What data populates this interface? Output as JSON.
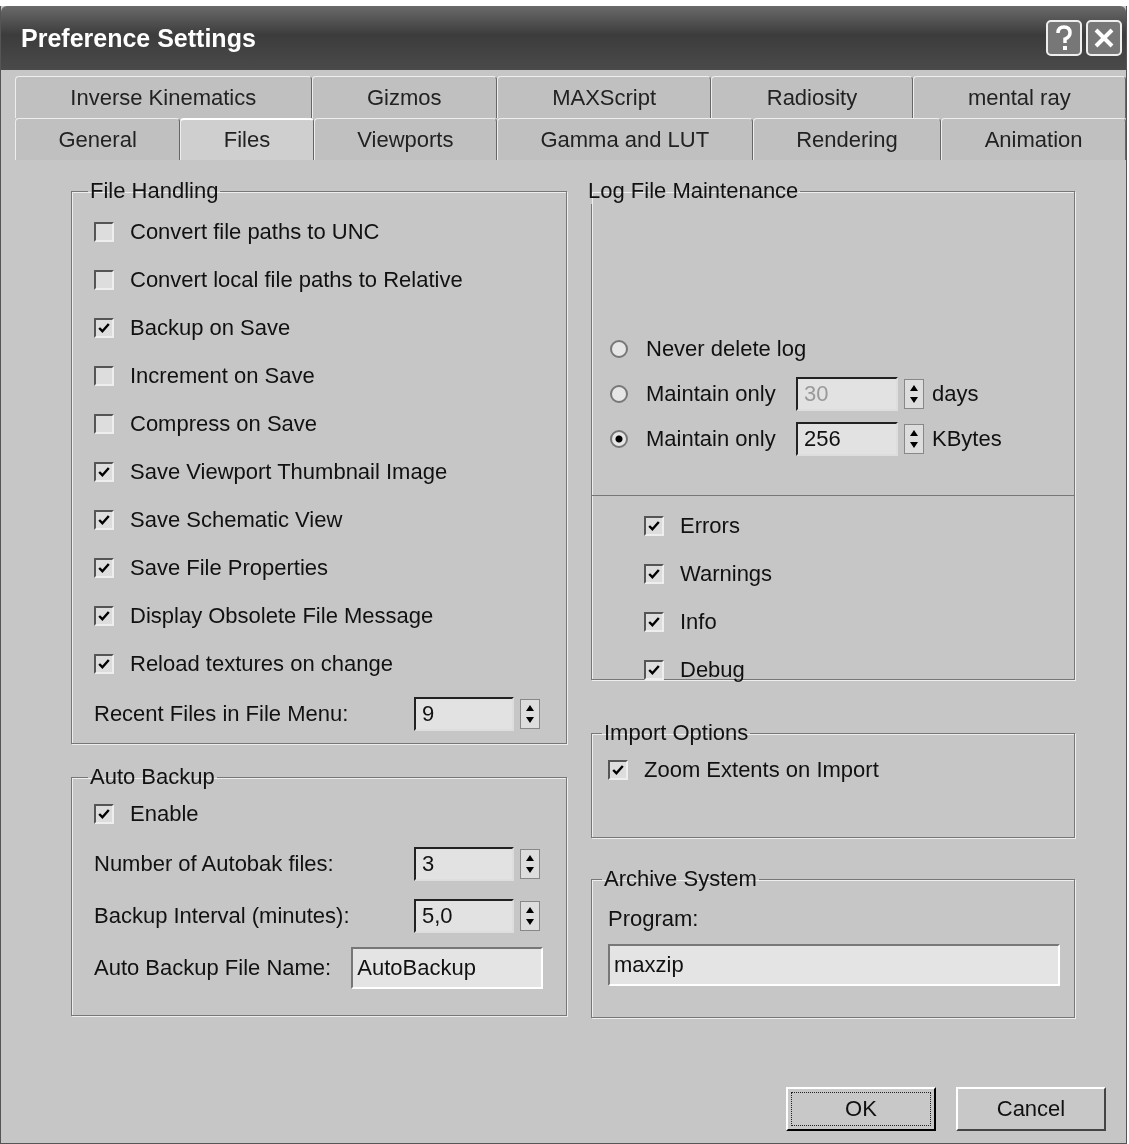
{
  "window": {
    "title": "Preference Settings"
  },
  "tab_rows": [
    {
      "tabs": [
        {
          "label": "Inverse Kinematics",
          "selected": false
        },
        {
          "label": "Gizmos",
          "selected": false
        },
        {
          "label": "MAXScript",
          "selected": false
        },
        {
          "label": "Radiosity",
          "selected": false
        },
        {
          "label": "mental ray",
          "selected": false
        }
      ]
    },
    {
      "tabs": [
        {
          "label": "General",
          "selected": false
        },
        {
          "label": "Files",
          "selected": true
        },
        {
          "label": "Viewports",
          "selected": false
        },
        {
          "label": "Gamma and LUT",
          "selected": false
        },
        {
          "label": "Rendering",
          "selected": false
        },
        {
          "label": "Animation",
          "selected": false
        }
      ]
    }
  ],
  "file_handling": {
    "title": "File Handling",
    "options": [
      {
        "label": "Convert file paths to UNC",
        "checked": false
      },
      {
        "label": "Convert local file paths to Relative",
        "checked": false
      },
      {
        "label": "Backup on Save",
        "checked": true
      },
      {
        "label": "Increment on Save",
        "checked": false
      },
      {
        "label": "Compress on Save",
        "checked": false
      },
      {
        "label": "Save Viewport Thumbnail Image",
        "checked": true
      },
      {
        "label": "Save Schematic View",
        "checked": true
      },
      {
        "label": "Save File Properties",
        "checked": true
      },
      {
        "label": "Display Obsolete File Message",
        "checked": true
      },
      {
        "label": "Reload textures on change",
        "checked": true
      }
    ],
    "recent_files": {
      "label": "Recent Files in File Menu:",
      "value": "9"
    }
  },
  "auto_backup": {
    "title": "Auto Backup",
    "enable": {
      "label": "Enable",
      "checked": true
    },
    "spinners": [
      {
        "label": "Number of Autobak files:",
        "value": "3"
      },
      {
        "label": "Backup Interval (minutes):",
        "value": "5,0"
      }
    ],
    "file_name": {
      "label": "Auto Backup File Name:",
      "value": "AutoBackup"
    }
  },
  "log_file": {
    "title": "Log File Maintenance",
    "options": [
      {
        "label": "Never delete log",
        "selected": false
      },
      {
        "label": "Maintain only",
        "selected": false,
        "spinner": {
          "value": "30",
          "disabled": true
        },
        "unit": "days"
      },
      {
        "label": "Maintain only",
        "selected": true,
        "spinner": {
          "value": "256",
          "disabled": false
        },
        "unit": "KBytes"
      }
    ],
    "levels": [
      {
        "label": "Errors",
        "checked": true
      },
      {
        "label": "Warnings",
        "checked": true
      },
      {
        "label": "Info",
        "checked": true
      },
      {
        "label": "Debug",
        "checked": true
      }
    ]
  },
  "import_options": {
    "title": "Import Options",
    "option": {
      "label": "Zoom Extents on Import",
      "checked": true
    }
  },
  "archive_system": {
    "title": "Archive System",
    "label": "Program:",
    "value": "maxzip"
  },
  "buttons": [
    {
      "label": "OK",
      "default": true
    },
    {
      "label": "Cancel",
      "default": false
    }
  ]
}
